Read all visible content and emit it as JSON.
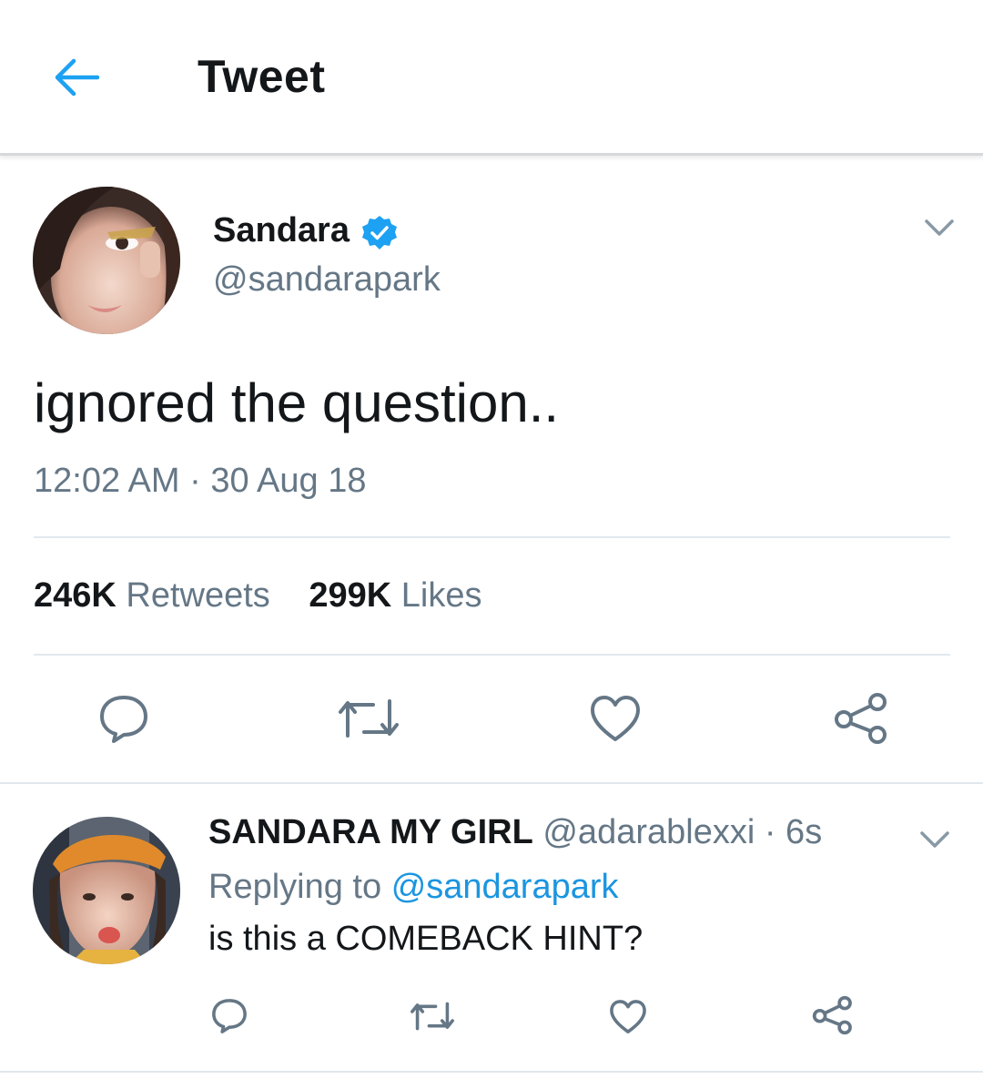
{
  "header": {
    "title": "Tweet",
    "back_icon": "arrow-left-icon"
  },
  "tweet": {
    "author_name": "Sandara",
    "author_handle": "@sandarapark",
    "verified": true,
    "text": "ignored the question..",
    "timestamp": "12:02 AM · 30 Aug 18",
    "stats": {
      "retweets_count": "246K",
      "retweets_label": "Retweets",
      "likes_count": "299K",
      "likes_label": "Likes"
    },
    "actions": [
      "reply-icon",
      "retweet-icon",
      "like-icon",
      "share-icon"
    ]
  },
  "reply": {
    "author_name": "SANDARA MY GIRL",
    "author_handle": "@adarablexxi",
    "time": "· 6s",
    "replying_prefix": "Replying to",
    "replying_to": "@sandarapark",
    "text": "is this a COMEBACK HINT?",
    "actions": [
      "reply-icon",
      "retweet-icon",
      "like-icon",
      "share-icon"
    ]
  },
  "colors": {
    "accent": "#1da1f2",
    "link": "#1b95e0",
    "secondary_text": "#657786",
    "divider": "#e1e8ed",
    "icon": "#657786"
  }
}
